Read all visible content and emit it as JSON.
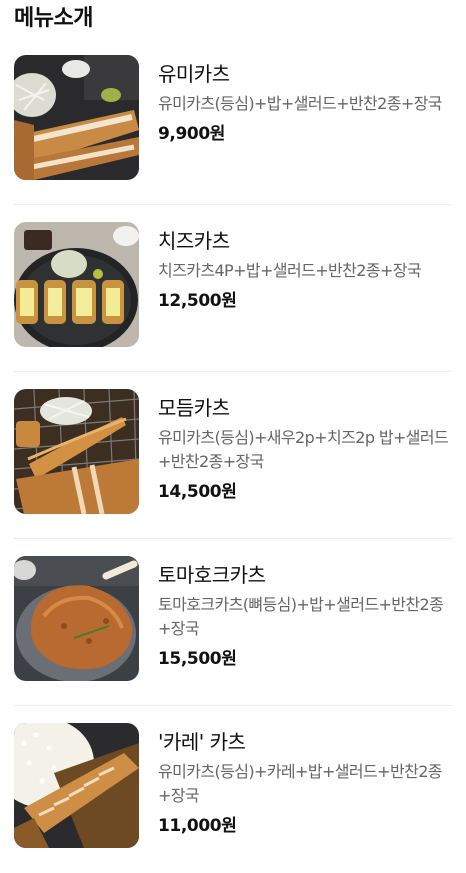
{
  "section": {
    "title": "메뉴소개"
  },
  "menu": [
    {
      "name": "유미카츠",
      "description": "유미카츠(등심)+밥+샐러드+반찬2종+장국",
      "price": "9,900원",
      "image": "yumi-katsu-photo"
    },
    {
      "name": "치즈카츠",
      "description": "치즈카츠4P+밥+샐러드+반찬2종+장국",
      "price": "12,500원",
      "image": "cheese-katsu-photo"
    },
    {
      "name": "모듬카츠",
      "description": "유미카츠(등심)+새우2p+치즈2p 밥+샐러드+반찬2종+장국",
      "price": "14,500원",
      "image": "assorted-katsu-photo"
    },
    {
      "name": "토마호크카츠",
      "description": "토마호크카츠(뼈등심)+밥+샐러드+반찬2종+장국",
      "price": "15,500원",
      "image": "tomahawk-katsu-photo"
    },
    {
      "name": "'카레' 카츠",
      "description": "유미카츠(등심)+카레+밥+샐러드+반찬2종+장국",
      "price": "11,000원",
      "image": "curry-katsu-photo"
    }
  ]
}
